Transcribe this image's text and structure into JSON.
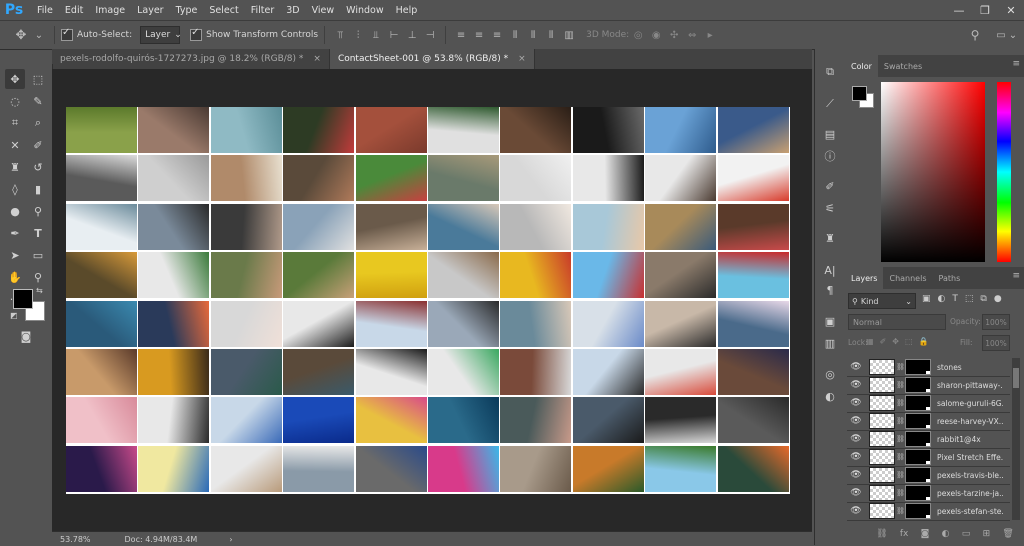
{
  "app": {
    "logo": "Ps"
  },
  "menu": [
    "File",
    "Edit",
    "Image",
    "Layer",
    "Type",
    "Select",
    "Filter",
    "3D",
    "View",
    "Window",
    "Help"
  ],
  "window_controls": {
    "minimize": "—",
    "restore": "❐",
    "close": "✕"
  },
  "options": {
    "auto_select_label": "Auto-Select:",
    "auto_select_target": "Layer",
    "transform_label": "Show Transform Controls",
    "mode_3d_label": "3D Mode:"
  },
  "tabs": [
    {
      "label": "pexels-rodolfo-quirós-1727273.jpg @ 18.2% (RGB/8) *",
      "close": "×"
    },
    {
      "label": "ContactSheet-001 @ 53.8% (RGB/8) *",
      "close": "×"
    }
  ],
  "status": {
    "zoom": "53.78%",
    "doc": "Doc: 4.94M/83.4M",
    "arrow": "›"
  },
  "color_panel": {
    "tabs": [
      "Color",
      "Swatches"
    ],
    "menu_icon": "≡",
    "foreground": "#000000",
    "background": "#ffffff"
  },
  "layers_panel": {
    "tabs": [
      "Layers",
      "Channels",
      "Paths"
    ],
    "menu_icon": "≡",
    "filter_kind": "Kind",
    "blend_mode": "Normal",
    "opacity_label": "Opacity:",
    "opacity_value": "100%",
    "lock_label": "Lock:",
    "fill_label": "Fill:",
    "fill_value": "100%",
    "layers": [
      "stones",
      "sharon-pittaway-...",
      "salome-guruli-6G...",
      "reese-harvey-VX...",
      "rabbit1@4x",
      "Pixel Stretch Effe...",
      "pexels-travis-ble...",
      "pexels-tarzine-ja...",
      "pexels-stefan-ste..."
    ]
  },
  "icons": {
    "move": "move-tool-icon",
    "marquee": "marquee-tool-icon",
    "lasso": "lasso-tool-icon",
    "search": "search-icon",
    "workspace": "workspace-icon",
    "eye": "eye-icon"
  },
  "thumbnail_grid": {
    "columns": 10,
    "rows": 8
  }
}
